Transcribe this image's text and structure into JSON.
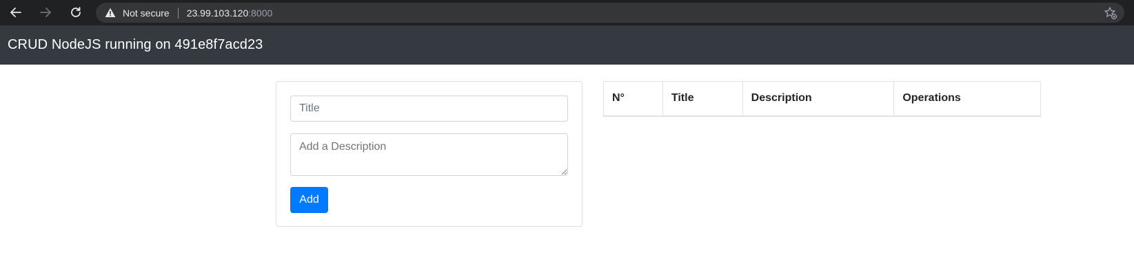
{
  "browser": {
    "security_label": "Not secure",
    "url_host": "23.99.103.120",
    "url_port": ":8000"
  },
  "navbar": {
    "brand": "CRUD NodeJS running on 491e8f7acd23"
  },
  "form": {
    "title_placeholder": "Title",
    "description_placeholder": "Add a Description",
    "add_label": "Add"
  },
  "table": {
    "headers": [
      "N°",
      "Title",
      "Description",
      "Operations"
    ],
    "rows": []
  },
  "colors": {
    "chrome_bg": "#202124",
    "navbar_bg": "#343a40",
    "primary": "#007bff"
  }
}
